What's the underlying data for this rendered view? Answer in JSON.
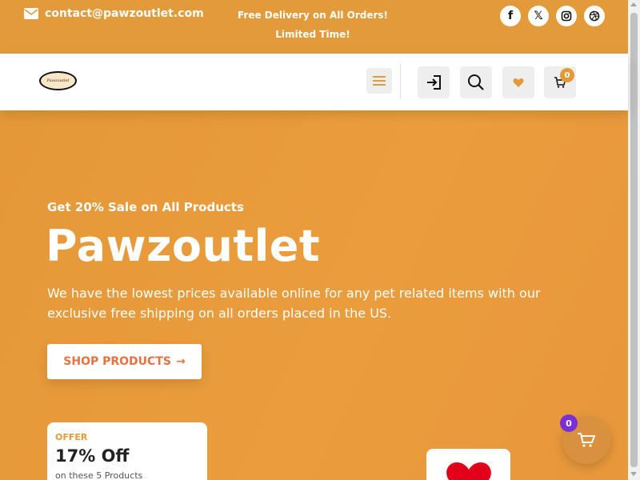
{
  "topbar": {
    "email": "contact@pawzoutlet.com",
    "promo": "Free Delivery on All Orders! Limited Time!",
    "socials": [
      {
        "name": "facebook-icon",
        "glyph": "f"
      },
      {
        "name": "x-twitter-icon",
        "glyph": "𝕏"
      },
      {
        "name": "instagram-icon"
      },
      {
        "name": "dribbble-icon"
      }
    ]
  },
  "header": {
    "logo_text": "Pawzoutlet",
    "cart_count": "0",
    "icons": [
      "menu-icon",
      "login-icon",
      "search-icon",
      "heart-icon",
      "cart-icon"
    ]
  },
  "hero": {
    "subtitle": "Get 20% Sale on All Products",
    "title": "Pawzoutlet",
    "description": "We have the lowest prices available online for any pet related items with our exclusive free shipping on all orders placed in the US.",
    "cta_label": "SHOP PRODUCTS",
    "cta_arrow": "→"
  },
  "offer": {
    "label": "OFFER",
    "value": "17% Off",
    "note": "on these 5 Products"
  },
  "floating_cart": {
    "count": "0"
  },
  "colors": {
    "brand_orange": "#e39a3a",
    "cta_text": "#e8723d",
    "badge_purple": "#7b2fd6",
    "heart_red": "#e3001b"
  }
}
